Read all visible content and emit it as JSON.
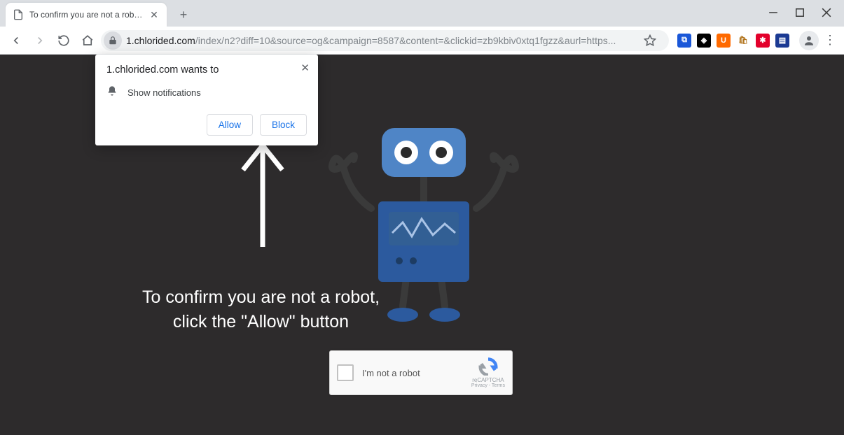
{
  "tab": {
    "title": "To confirm you are not a robot, c"
  },
  "url": {
    "host": "1.chlorided.com",
    "path": "/index/n2?diff=10&source=og&campaign=8587&content=&clickid=zb9kbiv0xtq1fgzz&aurl=https..."
  },
  "extensions": [
    {
      "name": "ext-1",
      "bg": "#1a57d8",
      "glyph": "⧉"
    },
    {
      "name": "ext-2",
      "bg": "#000000",
      "glyph": "◈"
    },
    {
      "name": "ext-3",
      "bg": "#ff6a00",
      "glyph": "U"
    },
    {
      "name": "ext-4",
      "bg": "#ffffff",
      "glyph": "🛍"
    },
    {
      "name": "ext-5",
      "bg": "#e3002b",
      "glyph": "✱"
    },
    {
      "name": "ext-6",
      "bg": "#1b3a93",
      "glyph": "▤"
    }
  ],
  "permission": {
    "title": "1.chlorided.com wants to",
    "item": "Show notifications",
    "allow": "Allow",
    "block": "Block"
  },
  "page": {
    "line1": "To confirm you are not a robot,",
    "line2": "click the \"Allow\" button"
  },
  "captcha": {
    "label": "I'm not a robot",
    "brand": "reCAPTCHA",
    "terms": "Privacy - Terms"
  }
}
